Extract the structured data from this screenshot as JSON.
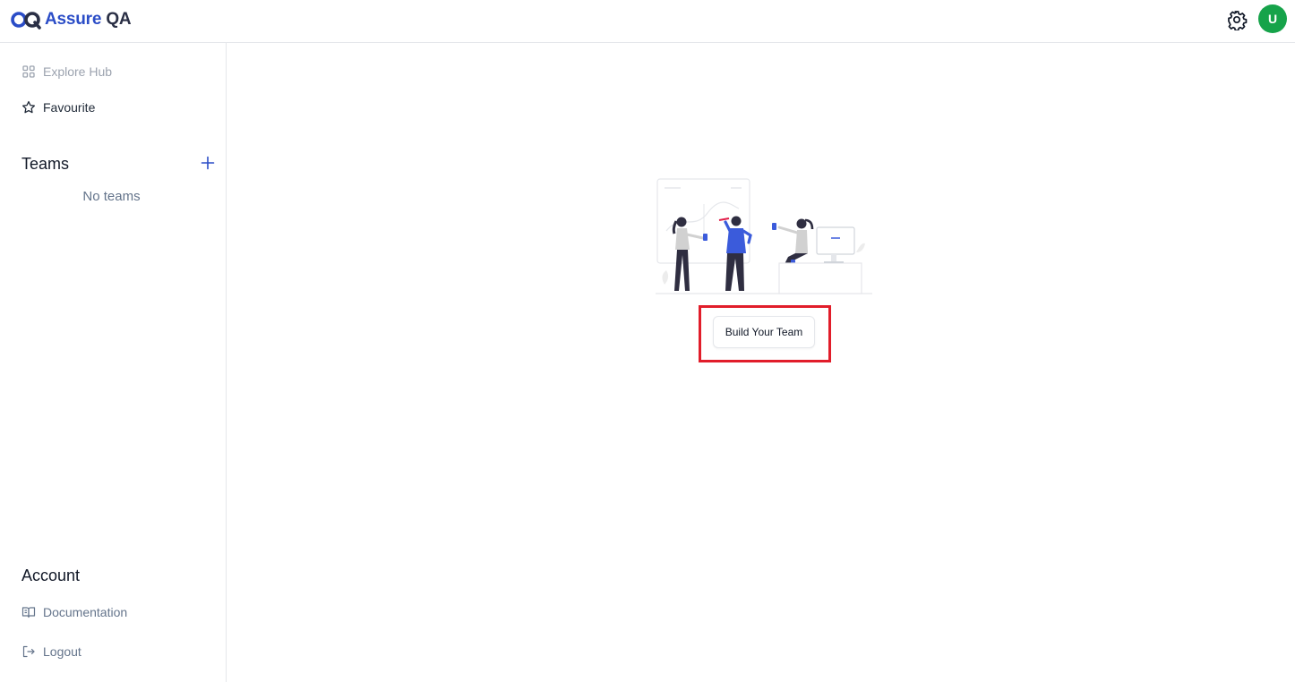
{
  "app": {
    "logo_main": "Assure",
    "logo_suffix": "QA",
    "avatar_initial": "U",
    "brand_color": "#2b4dc7",
    "avatar_color": "#16a34a"
  },
  "sidebar": {
    "explore_label": "Explore Hub",
    "favourite_label": "Favourite",
    "teams_title": "Teams",
    "no_teams": "No teams",
    "account_title": "Account",
    "documentation_label": "Documentation",
    "logout_label": "Logout"
  },
  "main": {
    "build_team_label": "Build Your Team",
    "highlight_color": "#e11d2a"
  },
  "icons": {
    "logo": "assure-qa-logo-icon",
    "settings": "gear-icon",
    "explore": "grid-icon",
    "favourite": "star-icon",
    "add_team": "plus-icon",
    "documentation": "book-icon",
    "logout": "logout-icon"
  }
}
